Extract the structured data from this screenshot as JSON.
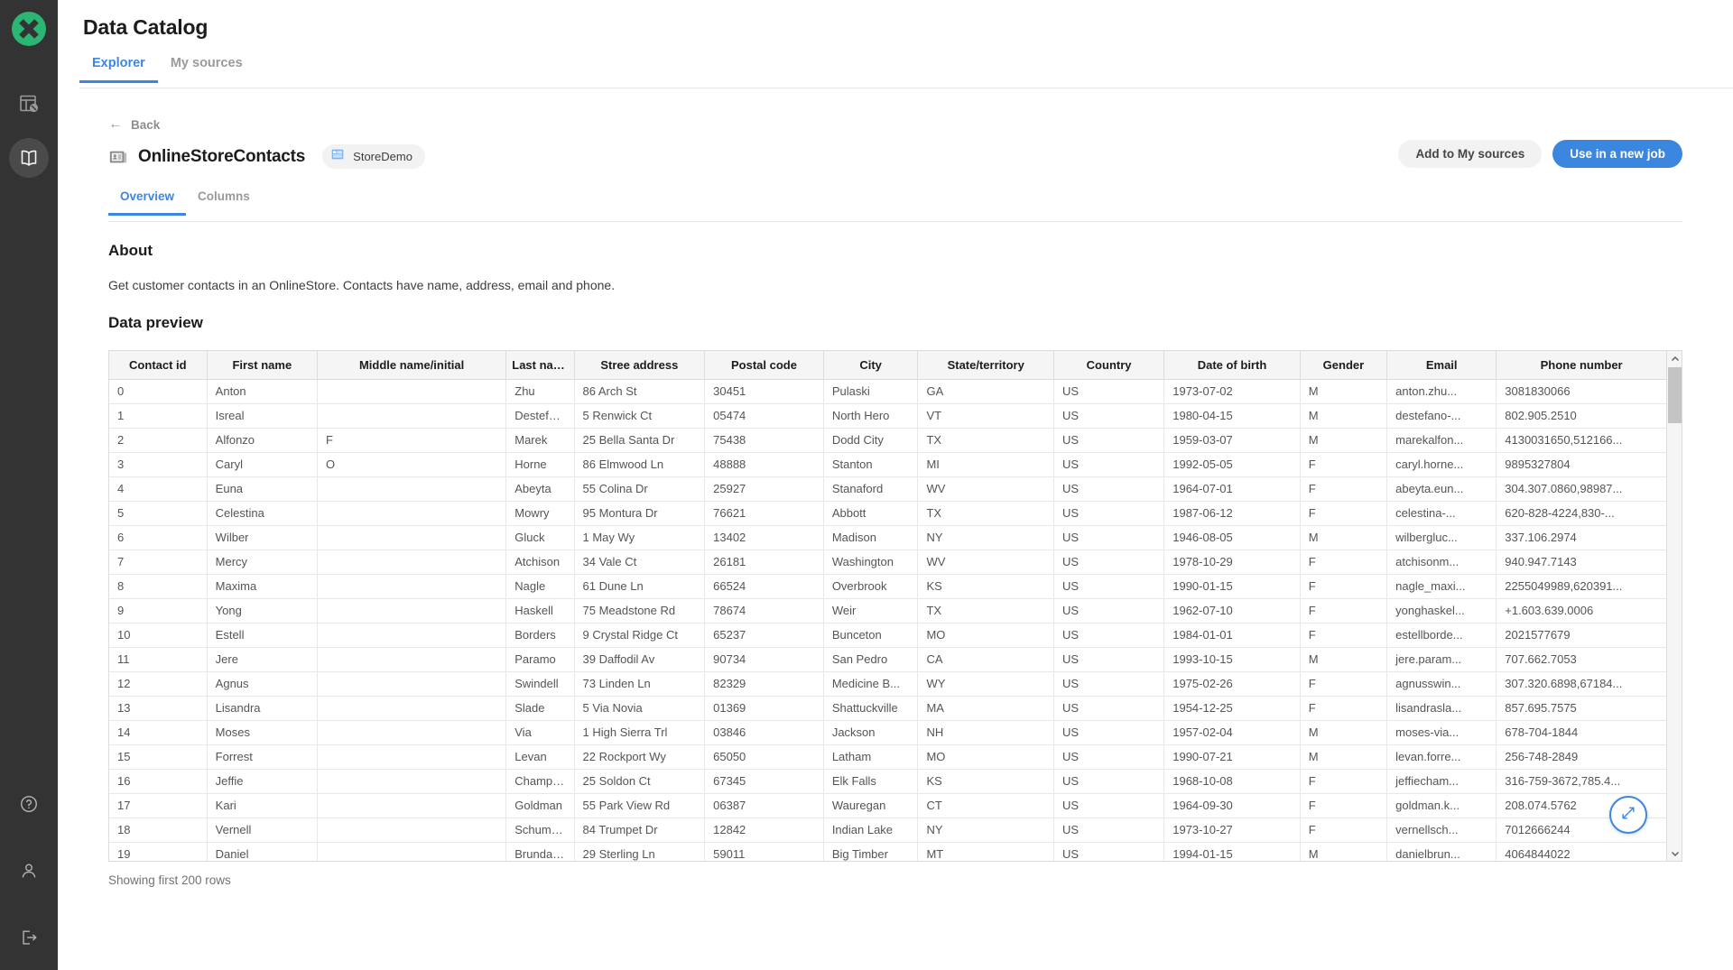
{
  "app": {
    "title": "Data Catalog",
    "logo_icon": "clover-logo-icon"
  },
  "rail": {
    "items": [
      {
        "name": "datasets-icon",
        "label": "Datasets",
        "active": false
      },
      {
        "name": "catalog-book-icon",
        "label": "Catalog",
        "active": true
      }
    ],
    "bottom_items": [
      {
        "name": "help-circle-icon",
        "label": "Help"
      },
      {
        "name": "user-account-icon",
        "label": "Account"
      },
      {
        "name": "logout-icon",
        "label": "Log out"
      }
    ]
  },
  "top_tabs": [
    {
      "label": "Explorer",
      "active": true
    },
    {
      "label": "My sources",
      "active": false
    }
  ],
  "back": {
    "label": "Back",
    "arrow": "←"
  },
  "dataset": {
    "name": "OnlineStoreContacts",
    "icon": "contacts-dataset-icon",
    "badge": {
      "label": "StoreDemo",
      "icon": "data-source-icon"
    }
  },
  "actions": {
    "add_to_my_sources": "Add to My sources",
    "use_in_new_job": "Use in a new job",
    "primary_color": "#3b87e0",
    "secondary_color": "#f2f2f2"
  },
  "sub_tabs": [
    {
      "label": "Overview",
      "active": true
    },
    {
      "label": "Columns",
      "active": false
    }
  ],
  "about": {
    "heading": "About",
    "description": "Get customer contacts in an OnlineStore. Contacts have name, address, email and phone."
  },
  "preview": {
    "heading": "Data preview",
    "rows_note": "Showing first 200 rows",
    "expand_icon": "expand-diagonal-icon",
    "scrollbar": {
      "up_icon": "chevron-up-icon",
      "down_icon": "chevron-down-icon"
    },
    "columns": [
      "Contact id",
      "First name",
      "Middle name/initial",
      "Last name",
      "Stree address",
      "Postal code",
      "City",
      "State/territory",
      "Country",
      "Date of birth",
      "Gender",
      "Email",
      "Phone number"
    ],
    "rows": [
      [
        "0",
        "Anton",
        "",
        "Zhu",
        "86 Arch St",
        "30451",
        "Pulaski",
        "GA",
        "US",
        "1973-07-02",
        "M",
        "anton.zhu...",
        "3081830066"
      ],
      [
        "1",
        "Isreal",
        "",
        "Destefano",
        "5 Renwick Ct",
        "05474",
        "North Hero",
        "VT",
        "US",
        "1980-04-15",
        "M",
        "destefano-...",
        "802.905.2510"
      ],
      [
        "2",
        "Alfonzo",
        "F",
        "Marek",
        "25 Bella Santa Dr",
        "75438",
        "Dodd City",
        "TX",
        "US",
        "1959-03-07",
        "M",
        "marekalfon...",
        "4130031650,512166..."
      ],
      [
        "3",
        "Caryl",
        "O",
        "Horne",
        "86 Elmwood Ln",
        "48888",
        "Stanton",
        "MI",
        "US",
        "1992-05-05",
        "F",
        "caryl.horne...",
        "9895327804"
      ],
      [
        "4",
        "Euna",
        "",
        "Abeyta",
        "55 Colina Dr",
        "25927",
        "Stanaford",
        "WV",
        "US",
        "1964-07-01",
        "F",
        "abeyta.eun...",
        "304.307.0860,98987..."
      ],
      [
        "5",
        "Celestina",
        "",
        "Mowry",
        "95 Montura Dr",
        "76621",
        "Abbott",
        "TX",
        "US",
        "1987-06-12",
        "F",
        "celestina-...",
        "620-828-4224,830-..."
      ],
      [
        "6",
        "Wilber",
        "",
        "Gluck",
        "1 May Wy",
        "13402",
        "Madison",
        "NY",
        "US",
        "1946-08-05",
        "M",
        "wilbergluc...",
        "337.106.2974"
      ],
      [
        "7",
        "Mercy",
        "",
        "Atchison",
        "34 Vale Ct",
        "26181",
        "Washington",
        "WV",
        "US",
        "1978-10-29",
        "F",
        "atchisonm...",
        "940.947.7143"
      ],
      [
        "8",
        "Maxima",
        "",
        "Nagle",
        "61 Dune Ln",
        "66524",
        "Overbrook",
        "KS",
        "US",
        "1990-01-15",
        "F",
        "nagle_maxi...",
        "2255049989,620391..."
      ],
      [
        "9",
        "Yong",
        "",
        "Haskell",
        "75 Meadstone Rd",
        "78674",
        "Weir",
        "TX",
        "US",
        "1962-07-10",
        "F",
        "yonghaskel...",
        "+1.603.639.0006"
      ],
      [
        "10",
        "Estell",
        "",
        "Borders",
        "9 Crystal Ridge Ct",
        "65237",
        "Bunceton",
        "MO",
        "US",
        "1984-01-01",
        "F",
        "estellborde...",
        "2021577679"
      ],
      [
        "11",
        "Jere",
        "",
        "Paramo",
        "39 Daffodil Av",
        "90734",
        "San Pedro",
        "CA",
        "US",
        "1993-10-15",
        "M",
        "jere.param...",
        "707.662.7053"
      ],
      [
        "12",
        "Agnus",
        "",
        "Swindell",
        "73 Linden Ln",
        "82329",
        "Medicine B...",
        "WY",
        "US",
        "1975-02-26",
        "F",
        "agnusswin...",
        "307.320.6898,67184..."
      ],
      [
        "13",
        "Lisandra",
        "",
        "Slade",
        "5 Via Novia",
        "01369",
        "Shattuckville",
        "MA",
        "US",
        "1954-12-25",
        "F",
        "lisandrasla...",
        "857.695.7575"
      ],
      [
        "14",
        "Moses",
        "",
        "Via",
        "1 High Sierra Trl",
        "03846",
        "Jackson",
        "NH",
        "US",
        "1957-02-04",
        "M",
        "moses-via...",
        "678-704-1844"
      ],
      [
        "15",
        "Forrest",
        "",
        "Levan",
        "22 Rockport Wy",
        "65050",
        "Latham",
        "MO",
        "US",
        "1990-07-21",
        "M",
        "levan.forre...",
        "256-748-2849"
      ],
      [
        "16",
        "Jeffie",
        "",
        "Champion",
        "25 Soldon Ct",
        "67345",
        "Elk Falls",
        "KS",
        "US",
        "1968-10-08",
        "F",
        "jeffiecham...",
        "316-759-3672,785.4..."
      ],
      [
        "17",
        "Kari",
        "",
        "Goldman",
        "55 Park View Rd",
        "06387",
        "Wauregan",
        "CT",
        "US",
        "1964-09-30",
        "F",
        "goldman.k...",
        "208.074.5762"
      ],
      [
        "18",
        "Vernell",
        "",
        "Schumacher",
        "84 Trumpet Dr",
        "12842",
        "Indian Lake",
        "NY",
        "US",
        "1973-10-27",
        "F",
        "vernellsch...",
        "7012666244"
      ],
      [
        "19",
        "Daniel",
        "",
        "Brundage",
        "29 Sterling Ln",
        "59011",
        "Big Timber",
        "MT",
        "US",
        "1994-01-15",
        "M",
        "danielbrun...",
        "4064844022"
      ]
    ]
  }
}
